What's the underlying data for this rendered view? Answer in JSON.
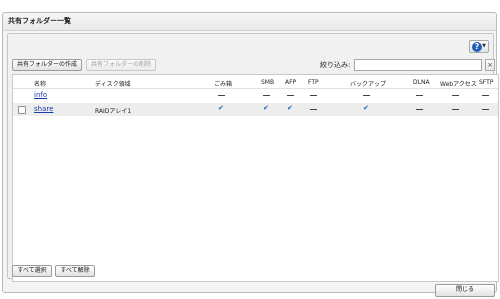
{
  "window": {
    "title": "共有フォルダー一覧"
  },
  "toolbar": {
    "create_label": "共有フォルダーの作成",
    "delete_label": "共有フォルダーの削除",
    "filter_label": "絞り込み:",
    "filter_value": "",
    "help_icon": "question-circle-icon"
  },
  "table": {
    "headers": {
      "name": "名称",
      "disk": "ディスク領域",
      "trash": "ごみ箱",
      "smb": "SMB",
      "afp": "AFP",
      "ftp": "FTP",
      "backup": "バックアップ",
      "dlna": "DLNA",
      "web": "Webアクセス",
      "sftp": "SFTP"
    },
    "rows": [
      {
        "name": "info",
        "disk": "",
        "trash": false,
        "smb": false,
        "afp": false,
        "ftp": false,
        "backup": false,
        "dlna": false,
        "web": false,
        "sftp": false,
        "selectable": false
      },
      {
        "name": "share",
        "disk": "RAIDアレイ1",
        "trash": true,
        "smb": true,
        "afp": true,
        "ftp": false,
        "backup": true,
        "dlna": false,
        "web": false,
        "sftp": false,
        "selectable": true
      }
    ]
  },
  "footer": {
    "select_all_label": "すべて選択",
    "deselect_all_label": "すべて解除",
    "close_label": "閉じる"
  }
}
